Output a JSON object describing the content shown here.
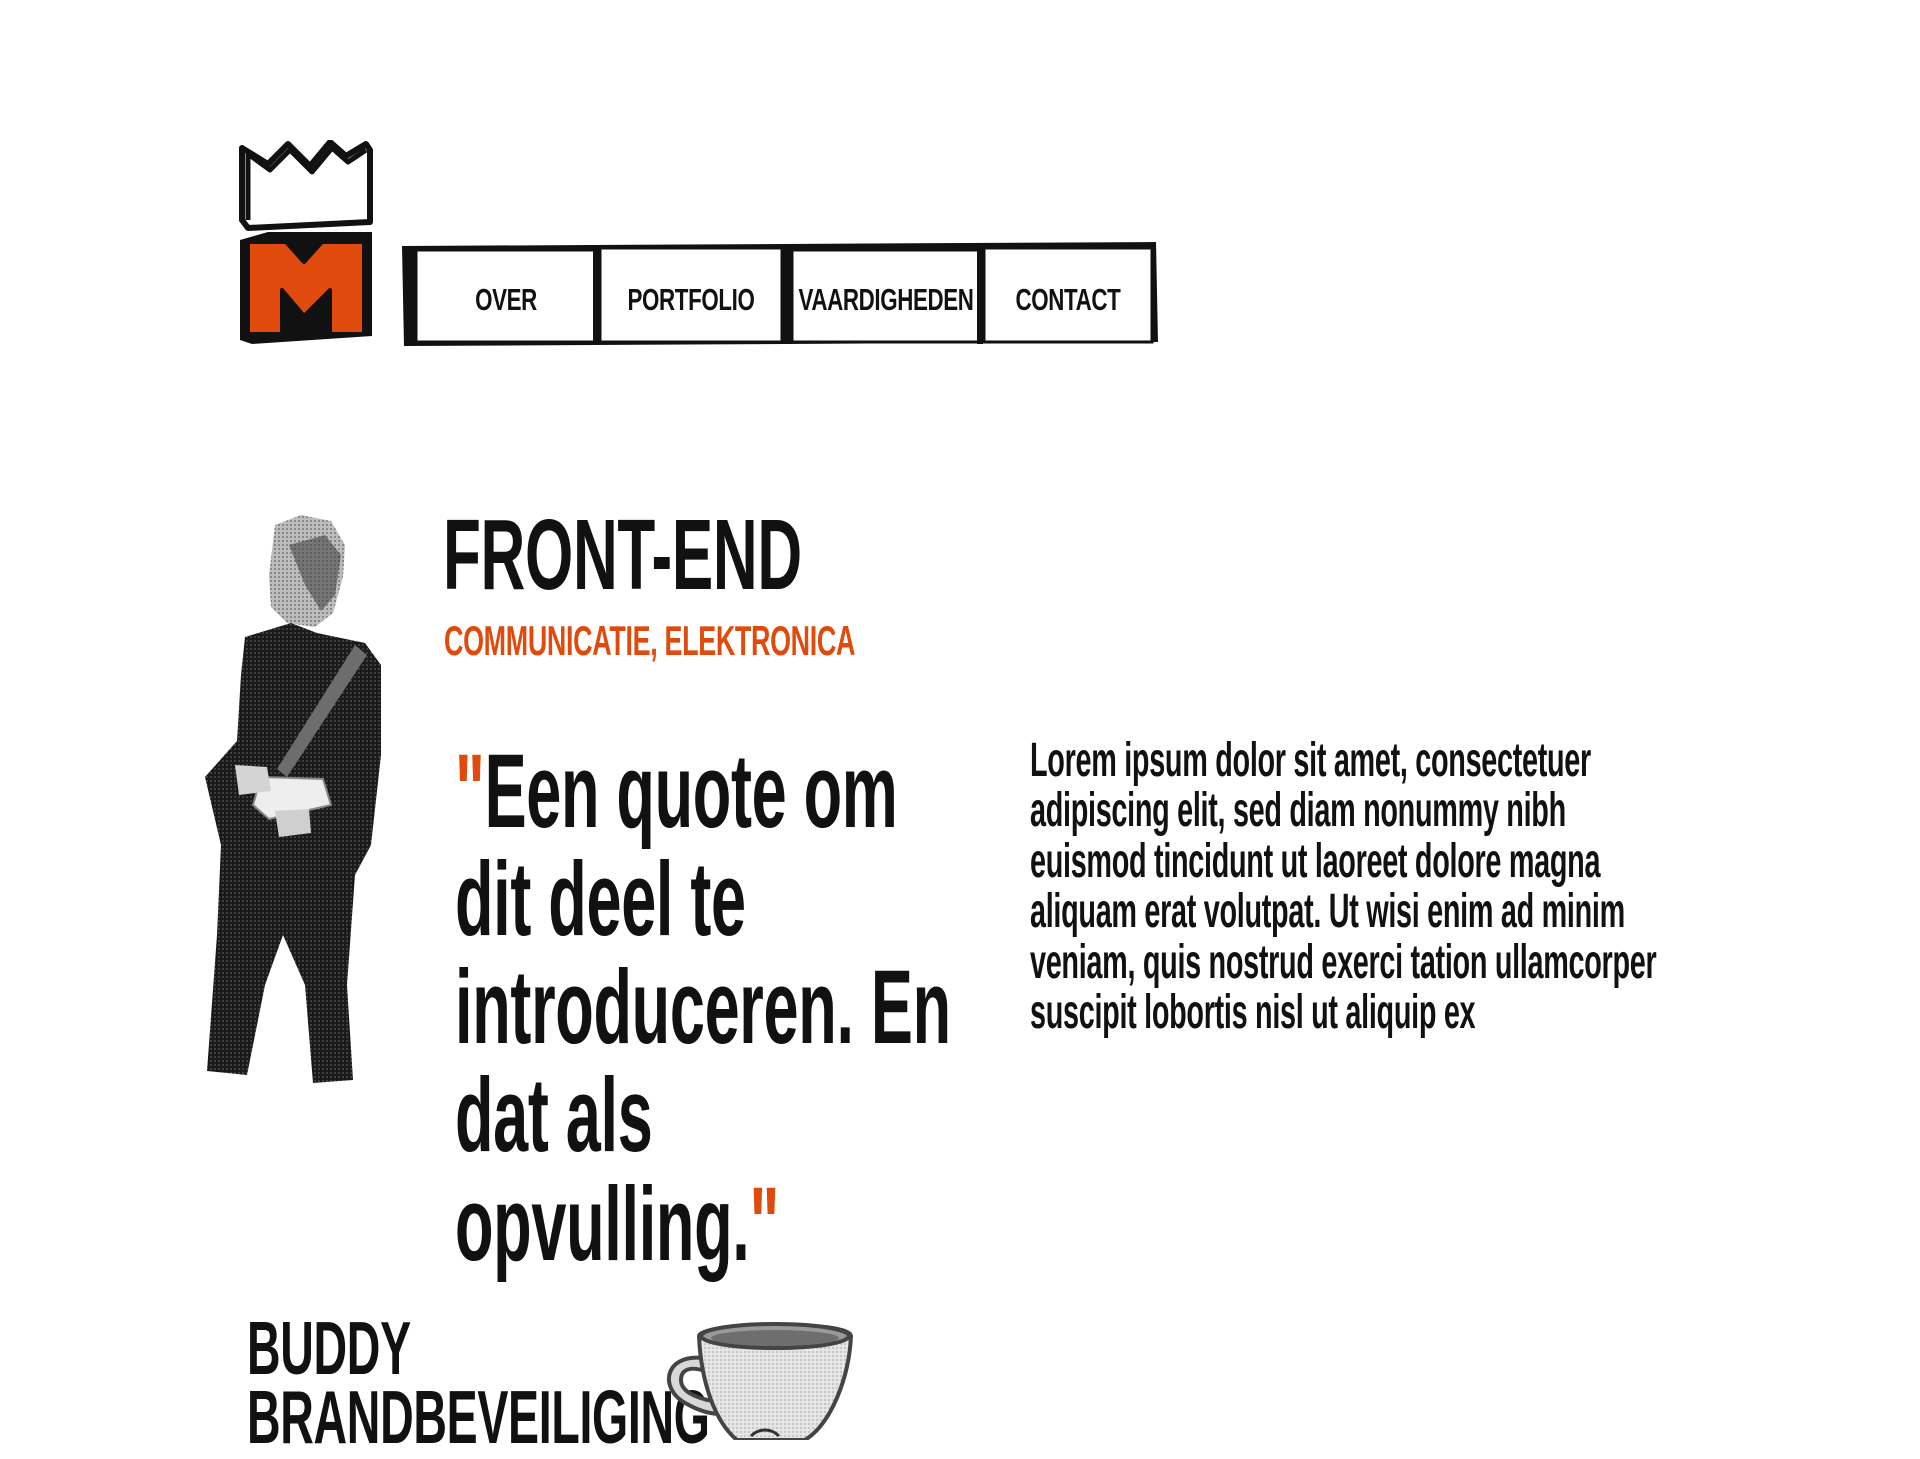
{
  "logo": {
    "icon": "crown-m-logo-icon",
    "letter": "M",
    "accent": "#e04a0d"
  },
  "nav": {
    "items": [
      {
        "label": "OVER"
      },
      {
        "label": "PORTFOLIO"
      },
      {
        "label": "VAARDIGHEDEN"
      },
      {
        "label": "CONTACT"
      }
    ]
  },
  "hero": {
    "photo": "person-photo",
    "title": "FRONT-END",
    "subtitle": "COMMUNICATIE, ELEKTRONICA",
    "quote_open": "\"",
    "quote_text": "Een quote om dit deel te introduceren. En dat als opvulling.",
    "quote_close": "\"",
    "body": "Lorem ipsum dolor sit amet, consectetuer adipiscing elit, sed diam nonummy nibh euismod tincidunt ut laoreet dolore magna aliquam erat volutpat. Ut wisi enim ad minim veniam, quis nostrud exerci tation ullamcorper suscipit lobortis nisl ut aliquip ex"
  },
  "project": {
    "title_line1": "BUDDY",
    "title_line2": "BRANDBEVEILIGING",
    "image": "coffee-cup-photo"
  },
  "colors": {
    "accent": "#e04a0d",
    "ink": "#111111",
    "background": "#ffffff"
  }
}
